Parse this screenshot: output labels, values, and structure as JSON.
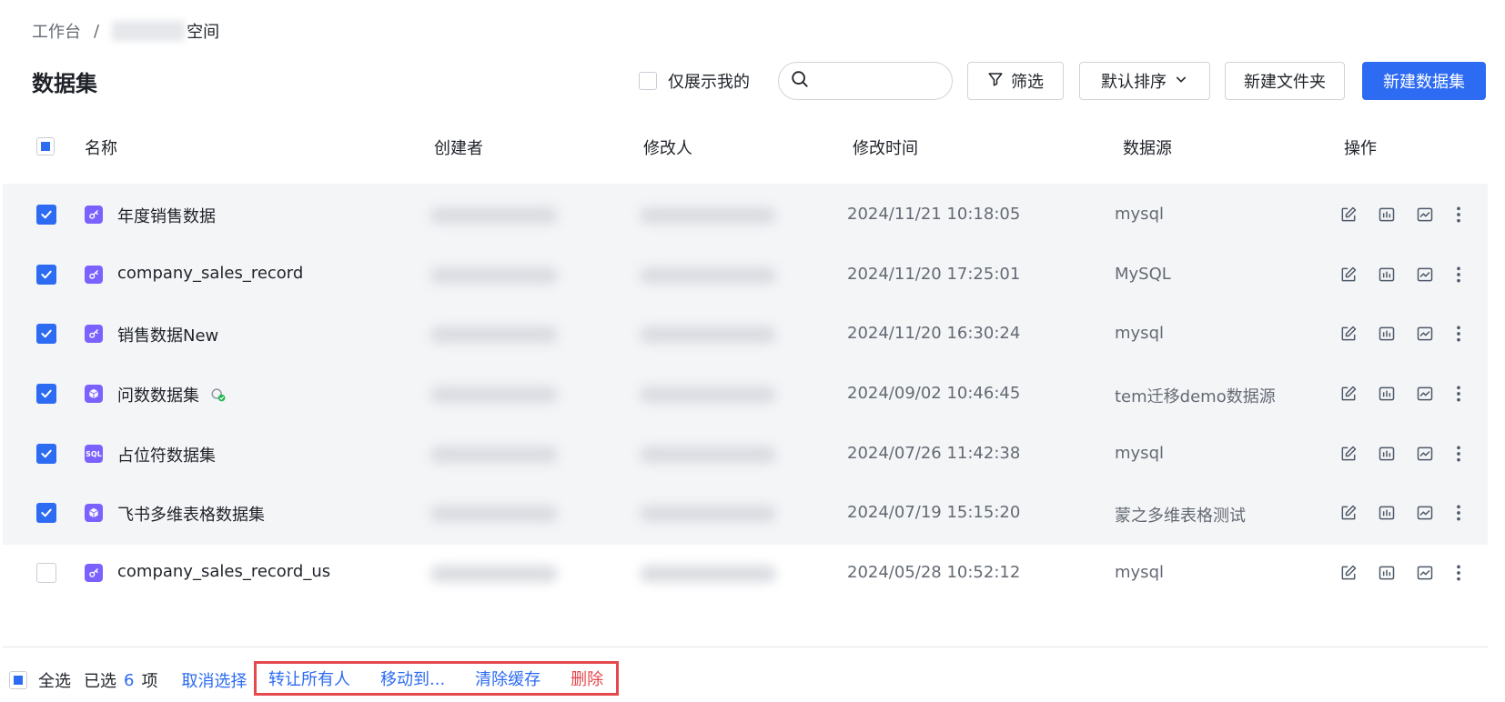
{
  "breadcrumb": {
    "root": "工作台",
    "separator": "/",
    "current": "空间"
  },
  "page_title": "数据集",
  "toolbar": {
    "only_mine_label": "仅展示我的",
    "search_placeholder": "",
    "filter_label": "筛选",
    "sort_label": "默认排序",
    "new_folder_label": "新建文件夹",
    "new_dataset_label": "新建数据集"
  },
  "columns": {
    "name": "名称",
    "creator": "创建者",
    "modifier": "修改人",
    "modified_time": "修改时间",
    "source": "数据源",
    "actions": "操作"
  },
  "rows": [
    {
      "name": "年度销售数据",
      "time": "2024/11/21 10:18:05",
      "source": "mysql",
      "selected": true,
      "icon": "key-icon"
    },
    {
      "name": "company_sales_record",
      "time": "2024/11/20 17:25:01",
      "source": "MySQL",
      "selected": true,
      "icon": "key-icon"
    },
    {
      "name": "销售数据New",
      "time": "2024/11/20 16:30:24",
      "source": "mysql",
      "selected": true,
      "icon": "key-icon"
    },
    {
      "name": "问数数据集",
      "time": "2024/09/02 10:46:45",
      "source": "tem迁移demo数据源",
      "selected": true,
      "icon": "cube-icon"
    },
    {
      "name": "占位符数据集",
      "time": "2024/07/26 11:42:38",
      "source": "mysql",
      "selected": true,
      "icon": "sql-icon",
      "icon_text": "SQL"
    },
    {
      "name": "飞书多维表格数据集",
      "time": "2024/07/19 15:15:20",
      "source": "蒙之多维表格测试",
      "selected": true,
      "icon": "cube-icon"
    },
    {
      "name": "company_sales_record_us",
      "time": "2024/05/28 10:52:12",
      "source": "mysql",
      "selected": false,
      "icon": "key-icon"
    }
  ],
  "footer": {
    "select_all_label": "全选",
    "selected_prefix": "已选",
    "selected_count": "6",
    "selected_suffix": "项",
    "cancel_label": "取消选择",
    "transfer_label": "转让所有人",
    "move_label": "移动到...",
    "clear_cache_label": "清除缓存",
    "delete_label": "删除"
  },
  "colors": {
    "accent": "#2c6bf2",
    "danger": "#e5484d",
    "dataset_icon": "#7b61ff"
  }
}
